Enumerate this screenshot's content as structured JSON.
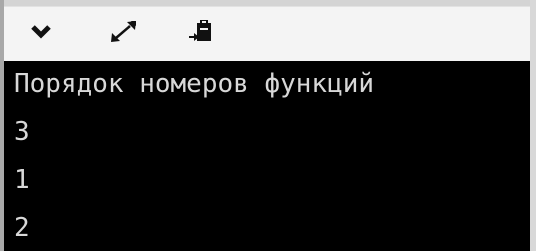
{
  "toolbar": {
    "buttons": [
      {
        "icon": "chevron-down-icon"
      },
      {
        "icon": "expand-icon"
      },
      {
        "icon": "clipboard-paste-icon"
      }
    ]
  },
  "console": {
    "lines": [
      "Порядок номеров функций",
      "3",
      "1",
      "2"
    ]
  },
  "colors": {
    "console_bg": "#000000",
    "console_text": "#d8d8d8",
    "toolbar_bg": "#f4f4f4"
  }
}
